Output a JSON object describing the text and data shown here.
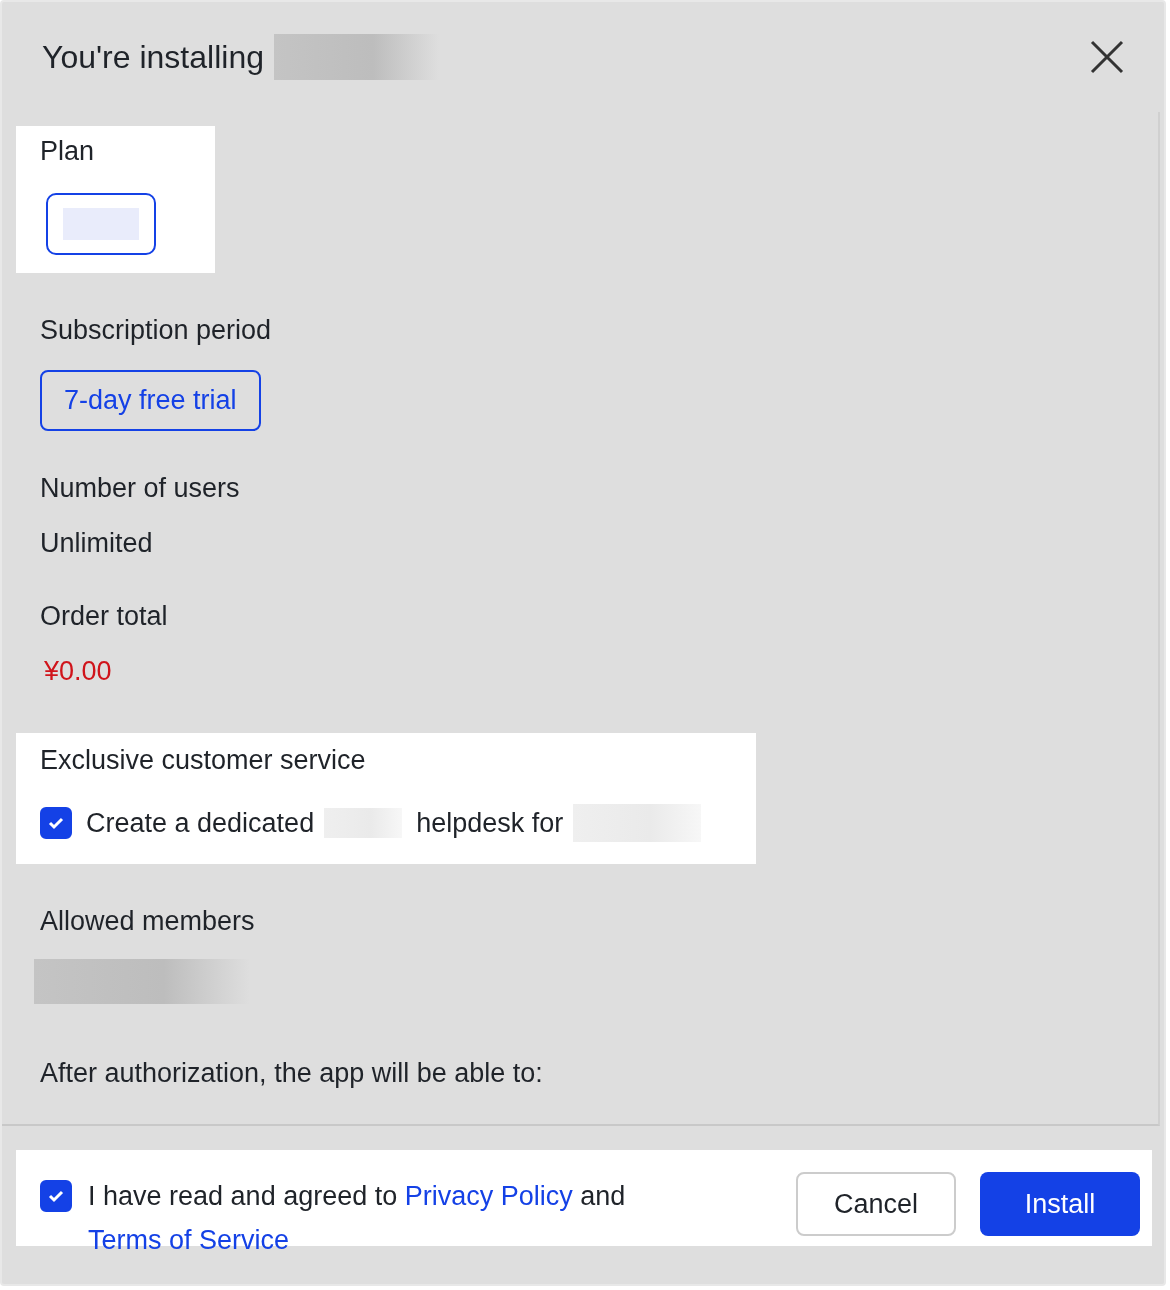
{
  "dialog": {
    "title": "You're installing"
  },
  "plan": {
    "label": "Plan",
    "options": [
      {
        "selected": true
      }
    ]
  },
  "subscription": {
    "label": "Subscription period",
    "options": [
      {
        "label": "7-day free trial",
        "selected": true
      }
    ]
  },
  "users": {
    "label": "Number of users",
    "value": "Unlimited"
  },
  "order_total": {
    "label": "Order total",
    "value": "¥0.00"
  },
  "customer_service": {
    "label": "Exclusive customer service",
    "checked": true,
    "text_before": "Create a dedicated",
    "text_after": "helpdesk for"
  },
  "allowed_members": {
    "label": "Allowed members"
  },
  "permissions": {
    "heading": "After authorization, the app will be able to:"
  },
  "footer": {
    "agreement": {
      "checked": true,
      "text": "I have read and agreed to",
      "privacy_link": "Privacy Policy",
      "conjunction": "and",
      "terms_link": "Terms of Service"
    },
    "buttons": [
      {
        "label": "Cancel",
        "kind": "secondary"
      },
      {
        "label": "Install",
        "kind": "primary"
      }
    ]
  }
}
